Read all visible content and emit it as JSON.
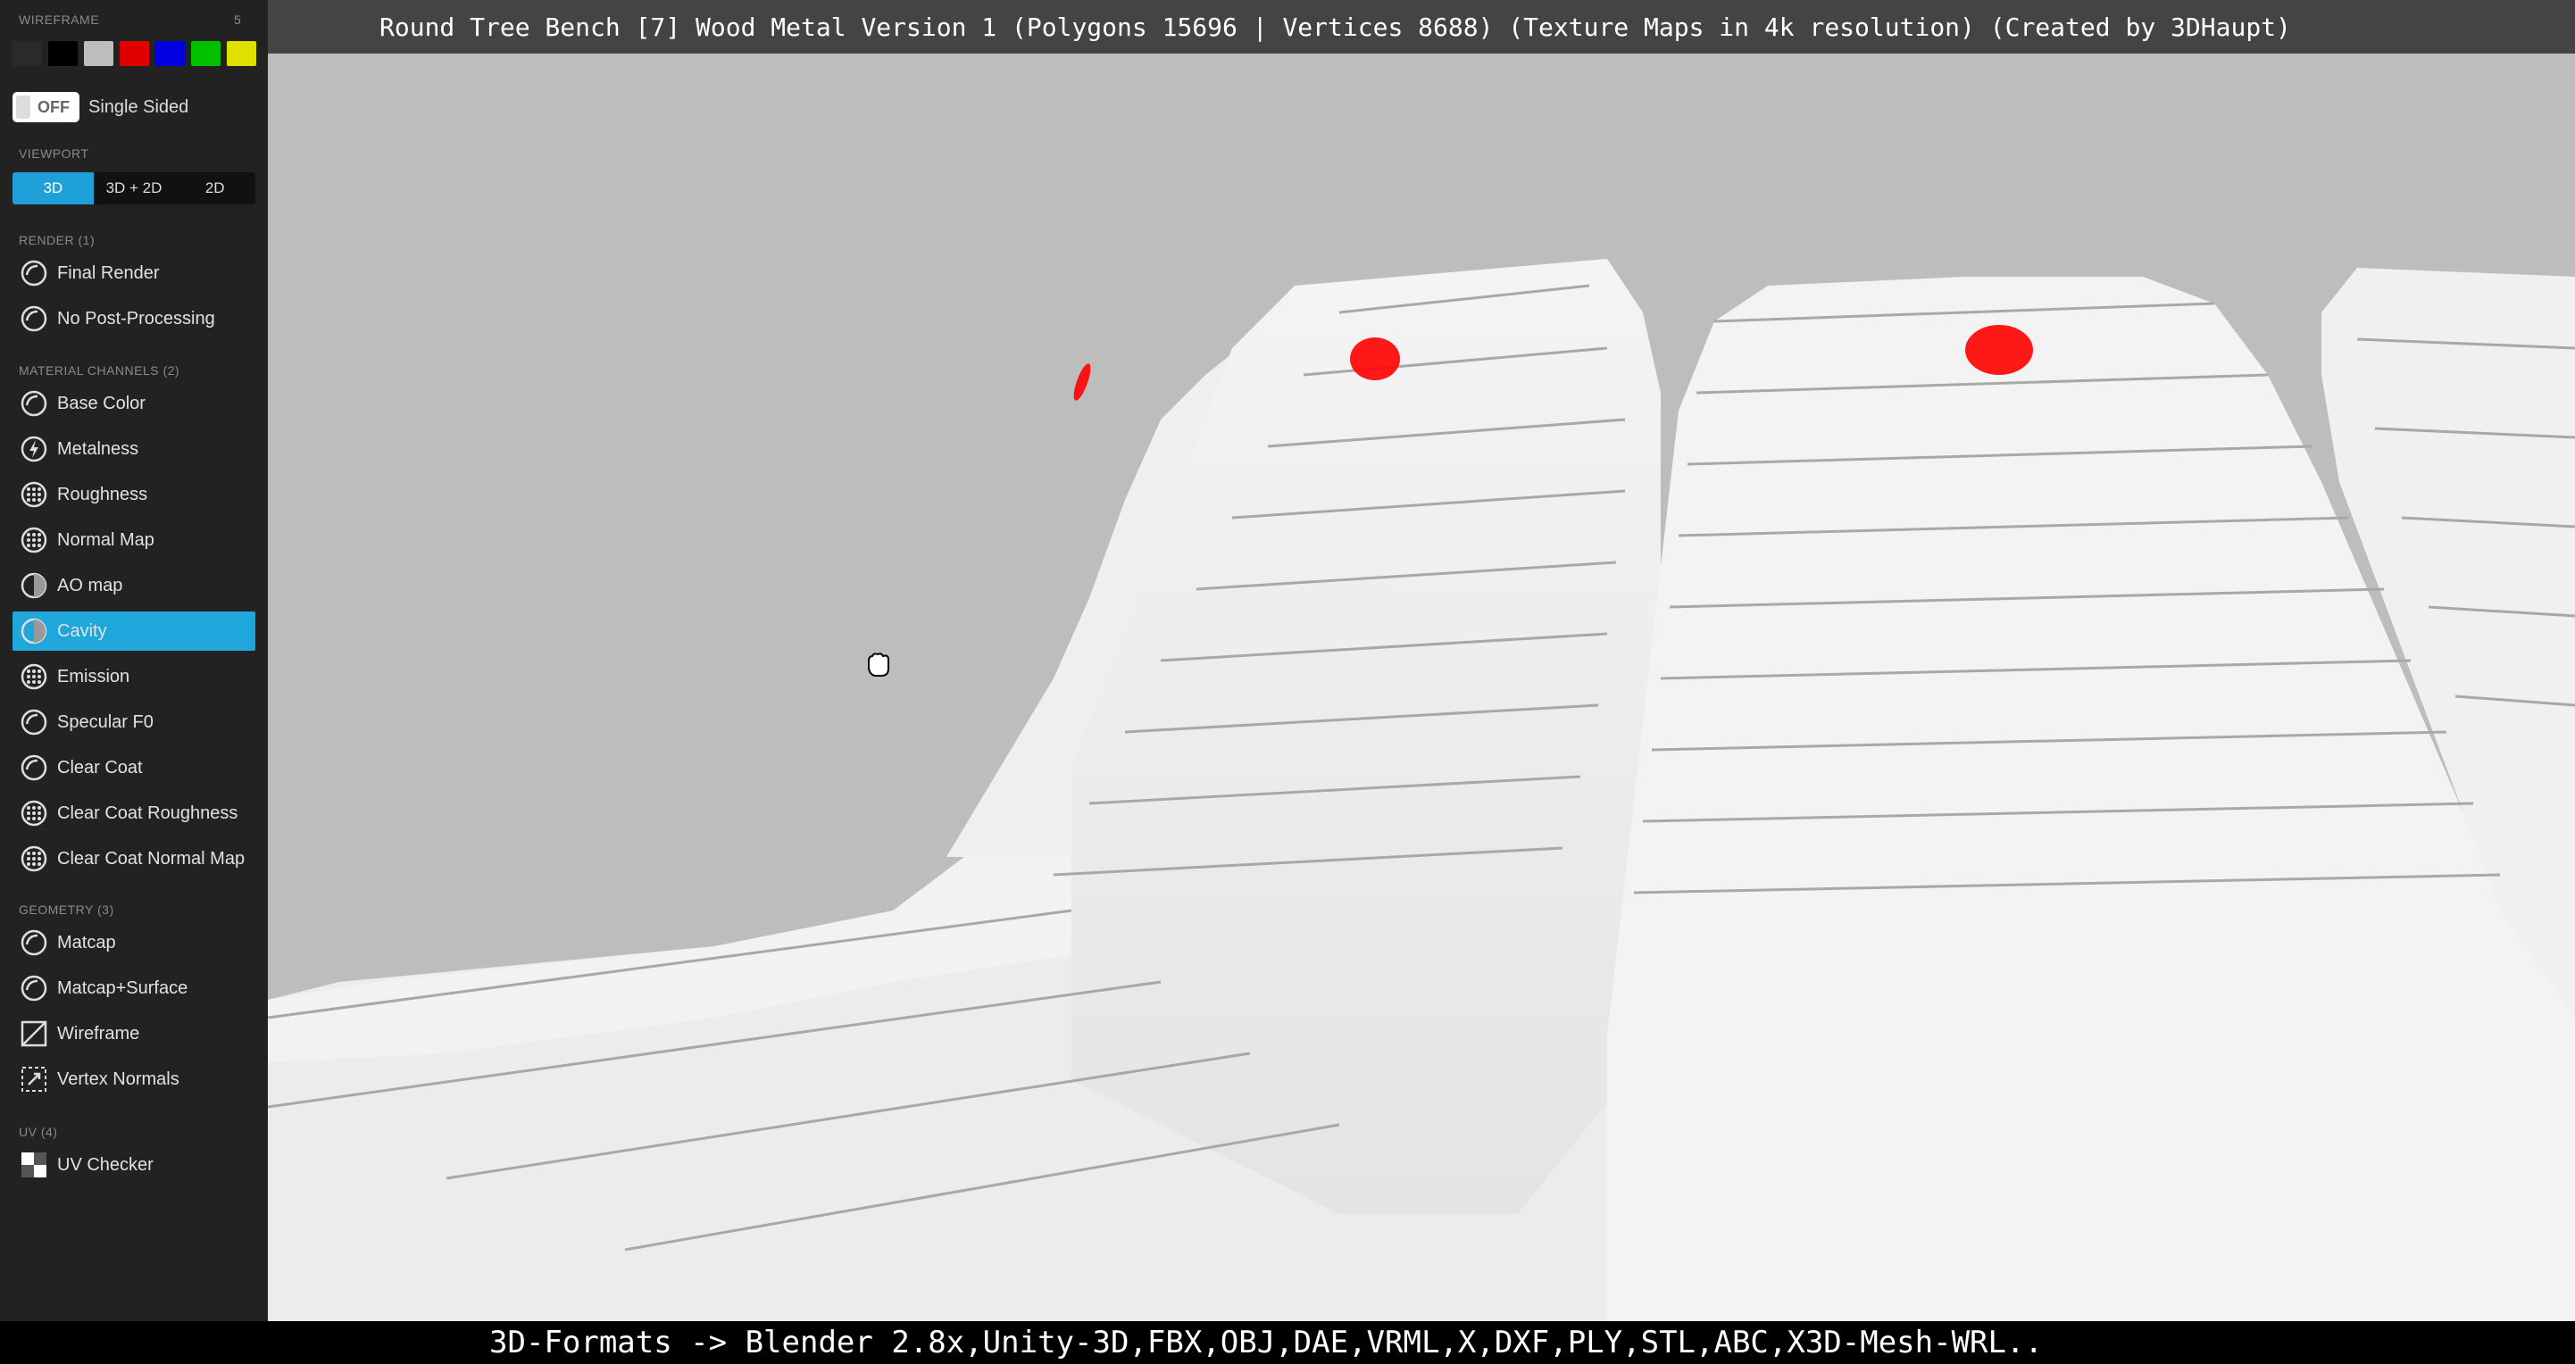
{
  "topbar": {
    "title": "Round Tree Bench [7] Wood Metal Version 1 (Polygons 15696 | Vertices 8688) (Texture Maps in 4k resolution) (Created by 3DHaupt)"
  },
  "bottombar": {
    "text": "3D-Formats -> Blender 2.8x,Unity-3D,FBX,OBJ,DAE,VRML,X,DXF,PLY,STL,ABC,X3D-Mesh-WRL.."
  },
  "sidebar": {
    "wireframe": {
      "title": "WIREFRAME",
      "count": "5",
      "swatches": [
        "#2a2a2a",
        "#000000",
        "#bdbdbd",
        "#e00000",
        "#0000e0",
        "#00c000",
        "#e0e000"
      ]
    },
    "single_sided": {
      "state": "OFF",
      "label": "Single Sided"
    },
    "viewport": {
      "title": "VIEWPORT",
      "options": [
        "3D",
        "3D + 2D",
        "2D"
      ],
      "selected": "3D"
    },
    "render": {
      "title": "RENDER (1)",
      "items": [
        "Final Render",
        "No Post-Processing"
      ]
    },
    "material": {
      "title": "MATERIAL CHANNELS (2)",
      "items": [
        "Base Color",
        "Metalness",
        "Roughness",
        "Normal Map",
        "AO map",
        "Cavity",
        "Emission",
        "Specular F0",
        "Clear Coat",
        "Clear Coat Roughness",
        "Clear Coat Normal Map"
      ],
      "active": "Cavity"
    },
    "geometry": {
      "title": "GEOMETRY (3)",
      "items": [
        "Matcap",
        "Matcap+Surface",
        "Wireframe",
        "Vertex Normals"
      ]
    },
    "uv": {
      "title": "UV (4)",
      "items": [
        "UV Checker"
      ]
    }
  },
  "colors": {
    "accent": "#1fa7dc",
    "sidebar_bg": "#222222",
    "viewport_bg": "#bdbdbd",
    "marker": "#ff0000"
  },
  "icons": {
    "cursor": "hand-grab-icon"
  }
}
